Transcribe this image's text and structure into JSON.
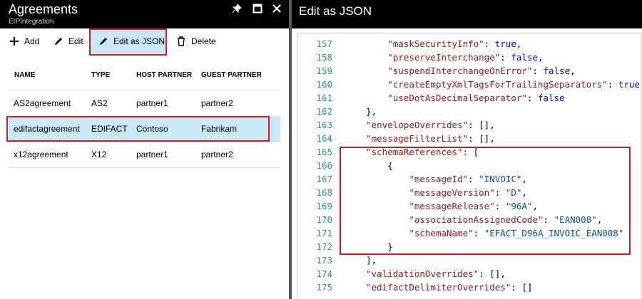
{
  "left_blade": {
    "title": "Agreements",
    "subtitle": "EIPIntegration",
    "header_icons": [
      "pin-icon",
      "maximize-icon",
      "close-icon"
    ],
    "toolbar": {
      "add_label": "Add",
      "edit_label": "Edit",
      "edit_json_label": "Edit as JSON",
      "delete_label": "Delete"
    },
    "columns": [
      "NAME",
      "TYPE",
      "HOST PARTNER",
      "GUEST PARTNER"
    ],
    "rows": [
      {
        "name": "AS2agreement",
        "type": "AS2",
        "host": "partner1",
        "guest": "partner2"
      },
      {
        "name": "edifactagreement",
        "type": "EDIFACT",
        "host": "Contoso",
        "guest": "Fabrikam"
      },
      {
        "name": "x12agreement",
        "type": "X12",
        "host": "partner1",
        "guest": "partner2"
      }
    ],
    "selected_row": 1
  },
  "right_blade": {
    "title": "Edit as JSON",
    "code_lines": [
      {
        "n": "157",
        "text": "        \"maskSecurityInfo\": true,"
      },
      {
        "n": "158",
        "text": "        \"preserveInterchange\": false,"
      },
      {
        "n": "159",
        "text": "        \"suspendInterchangeOnError\": false,"
      },
      {
        "n": "160",
        "text": "        \"createEmptyXmlTagsForTrailingSeparators\": true,"
      },
      {
        "n": "161",
        "text": "        \"useDotAsDecimalSeparator\": false"
      },
      {
        "n": "162",
        "text": "    },"
      },
      {
        "n": "163",
        "text": "    \"envelopeOverrides\": [],"
      },
      {
        "n": "164",
        "text": "    \"messageFilterList\": [],"
      },
      {
        "n": "165",
        "text": "    \"schemaReferences\": ["
      },
      {
        "n": "166",
        "text": "        {"
      },
      {
        "n": "167",
        "text": "            \"messageId\": \"INVOIC\","
      },
      {
        "n": "168",
        "text": "            \"messageVersion\": \"D\","
      },
      {
        "n": "169",
        "text": "            \"messageRelease\": \"96A\","
      },
      {
        "n": "170",
        "text": "            \"associationAssignedCode\": \"EAN008\","
      },
      {
        "n": "171",
        "text": "            \"schemaName\": \"EFACT_D96A_INVOIC_EAN008\""
      },
      {
        "n": "172",
        "text": "        }"
      },
      {
        "n": "173",
        "text": "    ],"
      },
      {
        "n": "174",
        "text": "    \"validationOverrides\": [],"
      },
      {
        "n": "175",
        "text": "    \"edifactDelimiterOverrides\": []"
      }
    ]
  },
  "colors": {
    "header_bg": "#000000",
    "selected_row_bg": "#cbe8f6",
    "highlight_border": "#d51c24",
    "line_number": "#2b91af",
    "json_key": "#a31515",
    "json_string": "#0451a5",
    "json_keyword": "#0000ff"
  }
}
